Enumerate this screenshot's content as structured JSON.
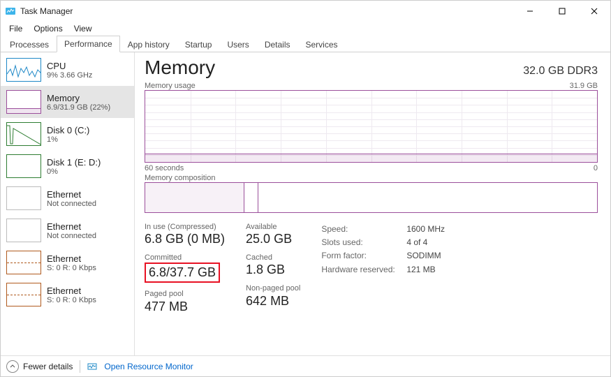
{
  "window": {
    "title": "Task Manager"
  },
  "menu": {
    "file": "File",
    "options": "Options",
    "view": "View"
  },
  "tabs": {
    "processes": "Processes",
    "performance": "Performance",
    "apphistory": "App history",
    "startup": "Startup",
    "users": "Users",
    "details": "Details",
    "services": "Services"
  },
  "sidebar": {
    "items": [
      {
        "name": "CPU",
        "sub": "9%  3.66 GHz",
        "style": "cpu"
      },
      {
        "name": "Memory",
        "sub": "6.9/31.9 GB (22%)",
        "style": "memory"
      },
      {
        "name": "Disk 0 (C:)",
        "sub": "1%",
        "style": "disk"
      },
      {
        "name": "Disk 1 (E: D:)",
        "sub": "0%",
        "style": "disk"
      },
      {
        "name": "Ethernet",
        "sub": "Not connected",
        "style": "eth-off"
      },
      {
        "name": "Ethernet",
        "sub": "Not connected",
        "style": "eth-off"
      },
      {
        "name": "Ethernet",
        "sub": "S: 0  R: 0 Kbps",
        "style": "eth"
      },
      {
        "name": "Ethernet",
        "sub": "S: 0  R: 0 Kbps",
        "style": "eth"
      }
    ]
  },
  "main": {
    "title": "Memory",
    "spec": "32.0 GB DDR3",
    "usage_label": "Memory usage",
    "usage_max": "31.9 GB",
    "axis_left": "60 seconds",
    "axis_right": "0",
    "comp_label": "Memory composition",
    "stats": {
      "inuse_label": "In use (Compressed)",
      "inuse": "6.8 GB (0 MB)",
      "available_label": "Available",
      "available": "25.0 GB",
      "committed_label": "Committed",
      "committed": "6.8/37.7 GB",
      "cached_label": "Cached",
      "cached": "1.8 GB",
      "paged_label": "Paged pool",
      "paged": "477 MB",
      "nonpaged_label": "Non-paged pool",
      "nonpaged": "642 MB"
    },
    "kv": {
      "speed_k": "Speed:",
      "speed_v": "1600 MHz",
      "slots_k": "Slots used:",
      "slots_v": "4 of 4",
      "form_k": "Form factor:",
      "form_v": "SODIMM",
      "hw_k": "Hardware reserved:",
      "hw_v": "121 MB"
    }
  },
  "footer": {
    "fewer": "Fewer details",
    "resmon": "Open Resource Monitor"
  },
  "chart_data": {
    "type": "line",
    "title": "Memory usage",
    "xlabel": "seconds ago",
    "ylabel": "GB",
    "ylim": [
      0,
      31.9
    ],
    "x": [
      60,
      50,
      40,
      30,
      20,
      10,
      0
    ],
    "values": [
      6.9,
      6.9,
      6.9,
      6.9,
      6.9,
      6.9,
      6.9
    ]
  }
}
